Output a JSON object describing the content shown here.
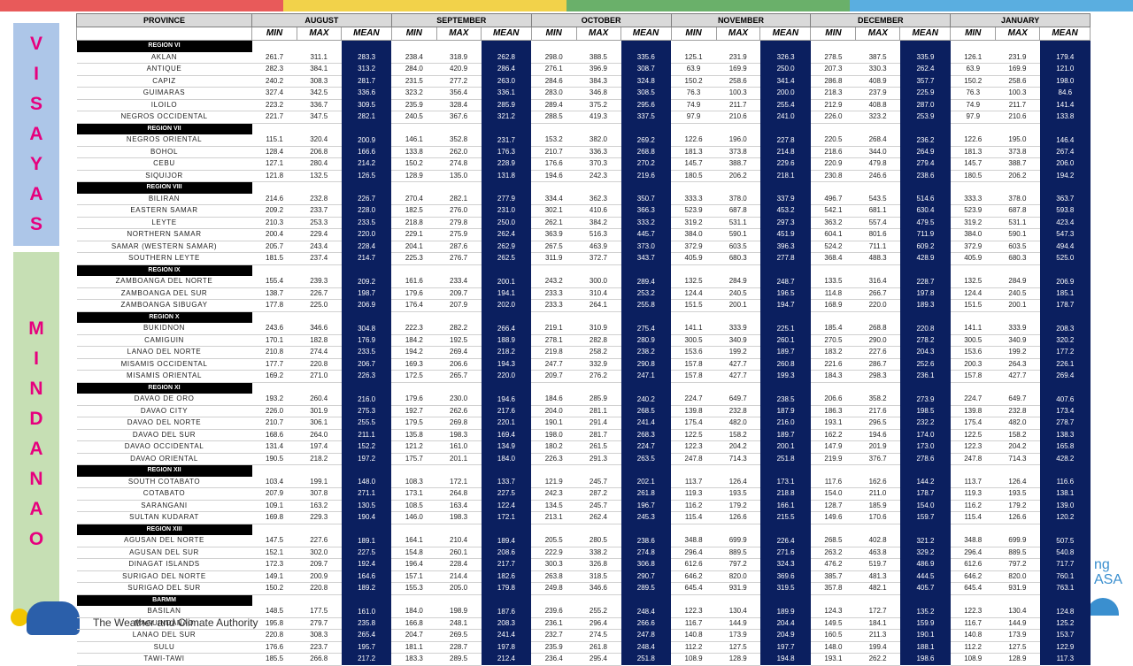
{
  "colors": {
    "topbar": [
      "#e85a5a",
      "#f2d24a",
      "#6ab06a",
      "#5aaee0"
    ],
    "mean_bg": "#0b1f5f",
    "region_bg": "#000000"
  },
  "side_labels": {
    "visayas": "VISAYAS",
    "mindanao": "MINDANAO"
  },
  "footer": {
    "agency": "The Weather and Climate Authority",
    "right_text": "ng\nASA"
  },
  "headers": {
    "province": "PROVINCE",
    "months": [
      "AUGUST",
      "SEPTEMBER",
      "OCTOBER",
      "NOVEMBER",
      "DECEMBER",
      "JANUARY"
    ],
    "sub": [
      "MIN",
      "MAX",
      "MEAN"
    ]
  },
  "rows": [
    {
      "region": "REGION VI"
    },
    {
      "p": "AKLAN",
      "v": [
        "261.7",
        "311.1",
        "283.3",
        "238.4",
        "318.9",
        "262.8",
        "298.0",
        "388.5",
        "335.6",
        "125.1",
        "231.9",
        "326.3",
        "278.5",
        "387.5",
        "335.9",
        "126.1",
        "231.9",
        "179.4"
      ]
    },
    {
      "p": "ANTIQUE",
      "v": [
        "282.3",
        "384.1",
        "313.2",
        "284.0",
        "420.9",
        "286.4",
        "276.1",
        "396.9",
        "308.7",
        "63.9",
        "169.9",
        "250.0",
        "207.3",
        "330.3",
        "262.4",
        "63.9",
        "169.9",
        "121.0"
      ]
    },
    {
      "p": "CAPIZ",
      "v": [
        "240.2",
        "308.3",
        "281.7",
        "231.5",
        "277.2",
        "263.0",
        "284.6",
        "384.3",
        "324.8",
        "150.2",
        "258.6",
        "341.4",
        "286.8",
        "408.9",
        "357.7",
        "150.2",
        "258.6",
        "198.0"
      ]
    },
    {
      "p": "GUIMARAS",
      "v": [
        "327.4",
        "342.5",
        "336.6",
        "323.2",
        "356.4",
        "336.1",
        "283.0",
        "346.8",
        "308.5",
        "76.3",
        "100.3",
        "200.0",
        "218.3",
        "237.9",
        "225.9",
        "76.3",
        "100.3",
        "84.6"
      ]
    },
    {
      "p": "ILOILO",
      "v": [
        "223.2",
        "336.7",
        "309.5",
        "235.9",
        "328.4",
        "285.9",
        "289.4",
        "375.2",
        "295.6",
        "74.9",
        "211.7",
        "255.4",
        "212.9",
        "408.8",
        "287.0",
        "74.9",
        "211.7",
        "141.4"
      ]
    },
    {
      "p": "NEGROS OCCIDENTAL",
      "v": [
        "221.7",
        "347.5",
        "282.1",
        "240.5",
        "367.6",
        "321.2",
        "288.5",
        "419.3",
        "337.5",
        "97.9",
        "210.6",
        "241.0",
        "226.0",
        "323.2",
        "253.9",
        "97.9",
        "210.6",
        "133.8"
      ]
    },
    {
      "region": "REGION VII"
    },
    {
      "p": "NEGROS ORIENTAL",
      "v": [
        "115.1",
        "320.4",
        "200.9",
        "146.1",
        "352.8",
        "231.7",
        "153.2",
        "382.0",
        "269.2",
        "122.6",
        "196.0",
        "227.8",
        "220.5",
        "268.4",
        "236.2",
        "122.6",
        "195.0",
        "146.4"
      ]
    },
    {
      "p": "BOHOL",
      "v": [
        "128.4",
        "206.8",
        "166.6",
        "133.8",
        "262.0",
        "176.3",
        "210.7",
        "336.3",
        "268.8",
        "181.3",
        "373.8",
        "214.8",
        "218.6",
        "344.0",
        "264.9",
        "181.3",
        "373.8",
        "267.4"
      ]
    },
    {
      "p": "CEBU",
      "v": [
        "127.1",
        "280.4",
        "214.2",
        "150.2",
        "274.8",
        "228.9",
        "176.6",
        "370.3",
        "270.2",
        "145.7",
        "388.7",
        "229.6",
        "220.9",
        "479.8",
        "279.4",
        "145.7",
        "388.7",
        "206.0"
      ]
    },
    {
      "p": "SIQUIJOR",
      "v": [
        "121.8",
        "132.5",
        "126.5",
        "128.9",
        "135.0",
        "131.8",
        "194.6",
        "242.3",
        "219.6",
        "180.5",
        "206.2",
        "218.1",
        "230.8",
        "246.6",
        "238.6",
        "180.5",
        "206.2",
        "194.2"
      ]
    },
    {
      "region": "REGION VIII"
    },
    {
      "p": "BILIRAN",
      "v": [
        "214.6",
        "232.8",
        "226.7",
        "270.4",
        "282.1",
        "277.9",
        "334.4",
        "362.3",
        "350.7",
        "333.3",
        "378.0",
        "337.9",
        "496.7",
        "543.5",
        "514.6",
        "333.3",
        "378.0",
        "363.7"
      ]
    },
    {
      "p": "EASTERN SAMAR",
      "v": [
        "209.2",
        "233.7",
        "228.0",
        "182.5",
        "276.0",
        "231.0",
        "302.1",
        "410.6",
        "366.3",
        "523.9",
        "687.8",
        "453.2",
        "542.1",
        "681.1",
        "630.4",
        "523.9",
        "687.8",
        "593.8"
      ]
    },
    {
      "p": "LEYTE",
      "v": [
        "210.3",
        "253.3",
        "233.5",
        "218.8",
        "279.8",
        "250.0",
        "262.1",
        "384.2",
        "333.2",
        "319.2",
        "531.1",
        "297.3",
        "363.2",
        "557.4",
        "479.5",
        "319.2",
        "531.1",
        "423.4"
      ]
    },
    {
      "p": "NORTHERN SAMAR",
      "v": [
        "200.4",
        "229.4",
        "220.0",
        "229.1",
        "275.9",
        "262.4",
        "363.9",
        "516.3",
        "445.7",
        "384.0",
        "590.1",
        "451.9",
        "604.1",
        "801.6",
        "711.9",
        "384.0",
        "590.1",
        "547.3"
      ]
    },
    {
      "p": "SAMAR (WESTERN SAMAR)",
      "v": [
        "205.7",
        "243.4",
        "228.4",
        "204.1",
        "287.6",
        "262.9",
        "267.5",
        "463.9",
        "373.0",
        "372.9",
        "603.5",
        "396.3",
        "524.2",
        "711.1",
        "609.2",
        "372.9",
        "603.5",
        "494.4"
      ]
    },
    {
      "p": "SOUTHERN LEYTE",
      "v": [
        "181.5",
        "237.4",
        "214.7",
        "225.3",
        "276.7",
        "262.5",
        "311.9",
        "372.7",
        "343.7",
        "405.9",
        "680.3",
        "277.8",
        "368.4",
        "488.3",
        "428.9",
        "405.9",
        "680.3",
        "525.0"
      ]
    },
    {
      "region": "REGION IX"
    },
    {
      "p": "ZAMBOANGA DEL NORTE",
      "v": [
        "155.4",
        "239.3",
        "209.2",
        "161.6",
        "233.4",
        "200.1",
        "243.2",
        "300.0",
        "289.4",
        "132.5",
        "284.9",
        "248.7",
        "133.5",
        "316.4",
        "228.7",
        "132.5",
        "284.9",
        "206.9"
      ]
    },
    {
      "p": "ZAMBOANGA DEL SUR",
      "v": [
        "138.7",
        "226.7",
        "198.7",
        "179.6",
        "209.7",
        "194.1",
        "233.3",
        "310.4",
        "253.2",
        "124.4",
        "240.5",
        "196.5",
        "114.8",
        "266.7",
        "197.8",
        "124.4",
        "240.5",
        "185.1"
      ]
    },
    {
      "p": "ZAMBOANGA SIBUGAY",
      "v": [
        "177.8",
        "225.0",
        "206.9",
        "176.4",
        "207.9",
        "202.0",
        "233.3",
        "264.1",
        "255.8",
        "151.5",
        "200.1",
        "194.7",
        "168.9",
        "220.0",
        "189.3",
        "151.5",
        "200.1",
        "178.7"
      ]
    },
    {
      "region": "REGION X"
    },
    {
      "p": "BUKIDNON",
      "v": [
        "243.6",
        "346.6",
        "304.8",
        "222.3",
        "282.2",
        "266.4",
        "219.1",
        "310.9",
        "275.4",
        "141.1",
        "333.9",
        "225.1",
        "185.4",
        "268.8",
        "220.8",
        "141.1",
        "333.9",
        "208.3"
      ]
    },
    {
      "p": "CAMIGUIN",
      "v": [
        "170.1",
        "182.8",
        "176.9",
        "184.2",
        "192.5",
        "188.9",
        "278.1",
        "282.8",
        "280.9",
        "300.5",
        "340.9",
        "260.1",
        "270.5",
        "290.0",
        "278.2",
        "300.5",
        "340.9",
        "320.2"
      ]
    },
    {
      "p": "LANAO DEL NORTE",
      "v": [
        "210.8",
        "274.4",
        "233.5",
        "194.2",
        "269.4",
        "218.2",
        "219.8",
        "258.2",
        "238.2",
        "153.6",
        "199.2",
        "189.7",
        "183.2",
        "227.6",
        "204.3",
        "153.6",
        "199.2",
        "177.2"
      ]
    },
    {
      "p": "MISAMIS OCCIDENTAL",
      "v": [
        "177.7",
        "220.8",
        "206.7",
        "169.3",
        "206.6",
        "194.3",
        "247.7",
        "332.9",
        "290.8",
        "157.8",
        "427.7",
        "260.8",
        "221.6",
        "286.7",
        "252.6",
        "200.3",
        "264.3",
        "226.1"
      ]
    },
    {
      "p": "MISAMIS ORIENTAL",
      "v": [
        "169.2",
        "271.0",
        "226.3",
        "172.5",
        "265.7",
        "220.0",
        "209.7",
        "276.2",
        "247.1",
        "157.8",
        "427.7",
        "199.3",
        "184.3",
        "298.3",
        "236.1",
        "157.8",
        "427.7",
        "269.4"
      ]
    },
    {
      "region": "REGION XI"
    },
    {
      "p": "DAVAO DE ORO",
      "v": [
        "193.2",
        "260.4",
        "216.0",
        "179.6",
        "230.0",
        "194.6",
        "184.6",
        "285.9",
        "240.2",
        "224.7",
        "649.7",
        "238.5",
        "206.6",
        "358.2",
        "273.9",
        "224.7",
        "649.7",
        "407.6"
      ]
    },
    {
      "p": "DAVAO CITY",
      "v": [
        "226.0",
        "301.9",
        "275.3",
        "192.7",
        "262.6",
        "217.6",
        "204.0",
        "281.1",
        "268.5",
        "139.8",
        "232.8",
        "187.9",
        "186.3",
        "217.6",
        "198.5",
        "139.8",
        "232.8",
        "173.4"
      ]
    },
    {
      "p": "DAVAO DEL NORTE",
      "v": [
        "210.7",
        "306.1",
        "255.5",
        "179.5",
        "269.8",
        "220.1",
        "190.1",
        "291.4",
        "241.4",
        "175.4",
        "482.0",
        "216.0",
        "193.1",
        "296.5",
        "232.2",
        "175.4",
        "482.0",
        "278.7"
      ]
    },
    {
      "p": "DAVAO DEL SUR",
      "v": [
        "168.6",
        "264.0",
        "211.1",
        "135.8",
        "198.3",
        "169.4",
        "198.0",
        "281.7",
        "268.3",
        "122.5",
        "158.2",
        "189.7",
        "162.2",
        "194.6",
        "174.0",
        "122.5",
        "158.2",
        "138.3"
      ]
    },
    {
      "p": "DAVAO OCCIDENTAL",
      "v": [
        "131.4",
        "197.4",
        "152.2",
        "121.2",
        "161.0",
        "134.9",
        "180.2",
        "261.5",
        "224.7",
        "122.3",
        "204.2",
        "200.1",
        "147.9",
        "201.9",
        "173.0",
        "122.3",
        "204.2",
        "165.8"
      ]
    },
    {
      "p": "DAVAO ORIENTAL",
      "v": [
        "190.5",
        "218.2",
        "197.2",
        "175.7",
        "201.1",
        "184.0",
        "226.3",
        "291.3",
        "263.5",
        "247.8",
        "714.3",
        "251.8",
        "219.9",
        "376.7",
        "278.6",
        "247.8",
        "714.3",
        "428.2"
      ]
    },
    {
      "region": "REGION XII"
    },
    {
      "p": "SOUTH COTABATO",
      "v": [
        "103.4",
        "199.1",
        "148.0",
        "108.3",
        "172.1",
        "133.7",
        "121.9",
        "245.7",
        "202.1",
        "113.7",
        "126.4",
        "173.1",
        "117.6",
        "162.6",
        "144.2",
        "113.7",
        "126.4",
        "116.6"
      ]
    },
    {
      "p": "COTABATO",
      "v": [
        "207.9",
        "307.8",
        "271.1",
        "173.1",
        "264.8",
        "227.5",
        "242.3",
        "287.2",
        "261.8",
        "119.3",
        "193.5",
        "218.8",
        "154.0",
        "211.0",
        "178.7",
        "119.3",
        "193.5",
        "138.1"
      ]
    },
    {
      "p": "SARANGANI",
      "v": [
        "109.1",
        "163.2",
        "130.5",
        "108.5",
        "163.4",
        "122.4",
        "134.5",
        "245.7",
        "196.7",
        "116.2",
        "179.2",
        "166.1",
        "128.7",
        "185.9",
        "154.0",
        "116.2",
        "179.2",
        "139.0"
      ]
    },
    {
      "p": "SULTAN KUDARAT",
      "v": [
        "169.8",
        "229.3",
        "190.4",
        "146.0",
        "198.3",
        "172.1",
        "213.1",
        "262.4",
        "245.3",
        "115.4",
        "126.6",
        "215.5",
        "149.6",
        "170.6",
        "159.7",
        "115.4",
        "126.6",
        "120.2"
      ]
    },
    {
      "region": "REGION XIII"
    },
    {
      "p": "AGUSAN DEL NORTE",
      "v": [
        "147.5",
        "227.6",
        "189.1",
        "164.1",
        "210.4",
        "189.4",
        "205.5",
        "280.5",
        "238.6",
        "348.8",
        "699.9",
        "226.4",
        "268.5",
        "402.8",
        "321.2",
        "348.8",
        "699.9",
        "507.5"
      ]
    },
    {
      "p": "AGUSAN DEL SUR",
      "v": [
        "152.1",
        "302.0",
        "227.5",
        "154.8",
        "260.1",
        "208.6",
        "222.9",
        "338.2",
        "274.8",
        "296.4",
        "889.5",
        "271.6",
        "263.2",
        "463.8",
        "329.2",
        "296.4",
        "889.5",
        "540.8"
      ]
    },
    {
      "p": "DINAGAT ISLANDS",
      "v": [
        "172.3",
        "209.7",
        "192.4",
        "196.4",
        "228.4",
        "217.7",
        "300.3",
        "326.8",
        "306.8",
        "612.6",
        "797.2",
        "324.3",
        "476.2",
        "519.7",
        "486.9",
        "612.6",
        "797.2",
        "717.7"
      ]
    },
    {
      "p": "SURIGAO DEL NORTE",
      "v": [
        "149.1",
        "200.9",
        "164.6",
        "157.1",
        "214.4",
        "182.6",
        "263.8",
        "318.5",
        "290.7",
        "646.2",
        "820.0",
        "369.6",
        "385.7",
        "481.3",
        "444.5",
        "646.2",
        "820.0",
        "760.1"
      ]
    },
    {
      "p": "SURIGAO DEL SUR",
      "v": [
        "150.2",
        "220.8",
        "189.2",
        "155.3",
        "205.0",
        "179.8",
        "249.8",
        "346.6",
        "289.5",
        "645.4",
        "931.9",
        "319.5",
        "357.8",
        "482.1",
        "405.7",
        "645.4",
        "931.9",
        "763.1"
      ]
    },
    {
      "region": "BARMM"
    },
    {
      "p": "BASILAN",
      "v": [
        "148.5",
        "177.5",
        "161.0",
        "184.0",
        "198.9",
        "187.6",
        "239.6",
        "255.2",
        "248.4",
        "122.3",
        "130.4",
        "189.9",
        "124.3",
        "172.7",
        "135.2",
        "122.3",
        "130.4",
        "124.8"
      ]
    },
    {
      "p": "MAGUINDANAO",
      "v": [
        "195.8",
        "279.7",
        "235.8",
        "166.8",
        "248.1",
        "208.3",
        "236.1",
        "296.4",
        "266.6",
        "116.7",
        "144.9",
        "204.4",
        "149.5",
        "184.1",
        "159.9",
        "116.7",
        "144.9",
        "125.2"
      ]
    },
    {
      "p": "LANAO DEL SUR",
      "v": [
        "220.8",
        "308.3",
        "265.4",
        "204.7",
        "269.5",
        "241.4",
        "232.7",
        "274.5",
        "247.8",
        "140.8",
        "173.9",
        "204.9",
        "160.5",
        "211.3",
        "190.1",
        "140.8",
        "173.9",
        "153.7"
      ]
    },
    {
      "p": "SULU",
      "v": [
        "176.6",
        "223.7",
        "195.7",
        "181.1",
        "228.7",
        "197.8",
        "235.9",
        "261.8",
        "248.4",
        "112.2",
        "127.5",
        "197.7",
        "148.0",
        "199.4",
        "188.1",
        "112.2",
        "127.5",
        "122.9"
      ]
    },
    {
      "p": "TAWI-TAWI",
      "v": [
        "185.5",
        "266.8",
        "217.2",
        "183.3",
        "289.5",
        "212.4",
        "236.4",
        "295.4",
        "251.8",
        "108.9",
        "128.9",
        "194.8",
        "193.1",
        "262.2",
        "198.6",
        "108.9",
        "128.9",
        "117.3"
      ]
    }
  ]
}
